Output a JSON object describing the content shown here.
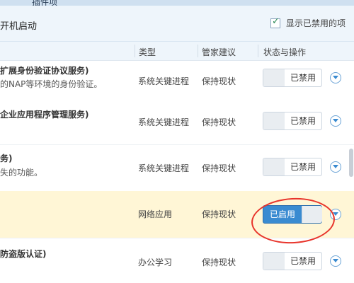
{
  "tabbar": {
    "label": "插件项"
  },
  "section": {
    "title": "开机启动",
    "show_disabled_label": "显示已禁用的项",
    "show_disabled_checked": true
  },
  "columns": {
    "type": "类型",
    "advice": "管家建议",
    "status": "状态与操作"
  },
  "rows": [
    {
      "name": "扩展身份验证协议服务)",
      "desc": "的NAP等环境的身份验证。",
      "type": "系统关键进程",
      "advice": "保持现状",
      "status_label": "已禁用",
      "enabled": false
    },
    {
      "name": "企业应用程序管理服务)",
      "desc": "",
      "type": "系统关键进程",
      "advice": "保持现状",
      "status_label": "已禁用",
      "enabled": false
    },
    {
      "name": "务)",
      "desc": "失的功能。",
      "type": "系统关键进程",
      "advice": "保持现状",
      "status_label": "已禁用",
      "enabled": false
    },
    {
      "name": "",
      "desc": "",
      "type": "网络应用",
      "advice": "保持现状",
      "status_label": "已启用",
      "enabled": true
    },
    {
      "name": "防盗版认证)",
      "desc": "",
      "type": "办公学习",
      "advice": "保持现状",
      "status_label": "已禁用",
      "enabled": false
    }
  ]
}
